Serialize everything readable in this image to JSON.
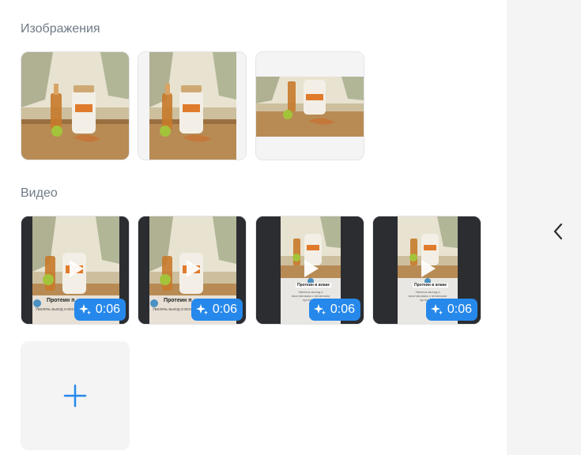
{
  "sections": {
    "images_title": "Изображения",
    "video_title": "Видео"
  },
  "images": [
    {
      "variant": "full",
      "icon": "product-photo"
    },
    {
      "variant": "padded-sides",
      "icon": "product-photo"
    },
    {
      "variant": "letterbox",
      "icon": "product-photo"
    }
  ],
  "videos": [
    {
      "duration": "0:06",
      "icon": "sparkle-icon",
      "caption": "Протеин п",
      "caption_sub": "Увеличь выход и восстановись"
    },
    {
      "duration": "0:06",
      "icon": "sparkle-icon",
      "caption": "Протеин п",
      "caption_sub": "Увеличь выход и восстановись"
    },
    {
      "duration": "0:06",
      "icon": "sparkle-icon",
      "caption": "Протеин в влаке",
      "caption_sub": "Увеличь выход и восстановись с веганским протеином"
    },
    {
      "duration": "0:06",
      "icon": "sparkle-icon",
      "caption": "Протеин в влаке",
      "caption_sub": "Увеличь выход и восстановись с веганским протеином"
    }
  ],
  "add_button": {
    "icon": "plus-icon"
  },
  "colors": {
    "accent": "#2688eb",
    "muted_text": "#707a86",
    "panel_bg": "#f4f4f5"
  }
}
